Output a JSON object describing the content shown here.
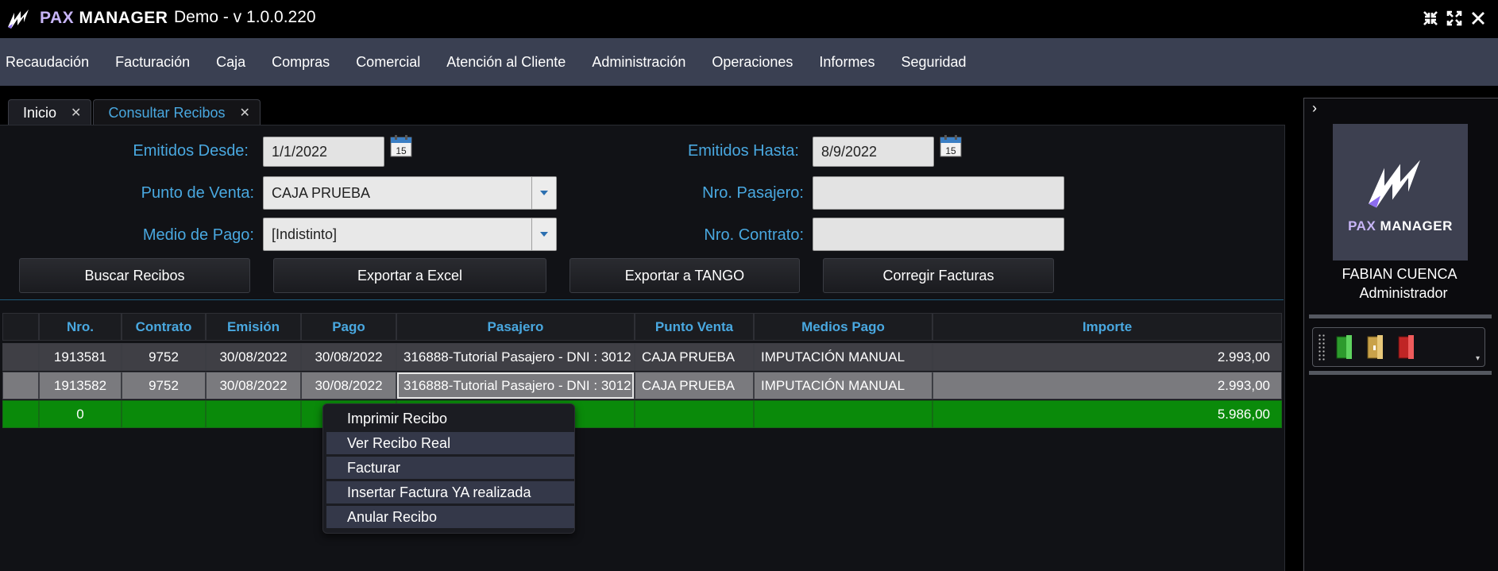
{
  "titlebar": {
    "logo_pax": "PAX",
    "logo_manager": "MANAGER",
    "title": "Demo - v 1.0.0.220"
  },
  "menu": [
    "Recaudación",
    "Facturación",
    "Caja",
    "Compras",
    "Comercial",
    "Atención al Cliente",
    "Administración",
    "Operaciones",
    "Informes",
    "Seguridad"
  ],
  "tabs": [
    {
      "label": "Inicio",
      "close": "✕"
    },
    {
      "label": "Consultar Recibos",
      "close": "✕"
    }
  ],
  "filters": {
    "desde_label": "Emitidos Desde:",
    "desde_value": "1/1/2022",
    "hasta_label": "Emitidos Hasta:",
    "hasta_value": "8/9/2022",
    "calendar_day": "15",
    "punto_label": "Punto de Venta:",
    "punto_value": "CAJA PRUEBA",
    "pasajero_label": "Nro. Pasajero:",
    "pasajero_value": "",
    "medio_label": "Medio de Pago:",
    "medio_value": "[Indistinto]",
    "contrato_label": "Nro. Contrato:",
    "contrato_value": ""
  },
  "buttons": {
    "buscar": "Buscar Recibos",
    "excel": "Exportar a Excel",
    "tango": "Exportar a TANGO",
    "corregir": "Corregir Facturas"
  },
  "grid": {
    "headers": [
      "Nro.",
      "Contrato",
      "Emisión",
      "Pago",
      "Pasajero",
      "Punto Venta",
      "Medios Pago",
      "Importe"
    ],
    "rows": [
      [
        "1913581",
        "9752",
        "30/08/2022",
        "30/08/2022",
        "316888-Tutorial Pasajero - DNI : 3012",
        "CAJA PRUEBA",
        "IMPUTACIÓN MANUAL",
        "2.993,00"
      ],
      [
        "1913582",
        "9752",
        "30/08/2022",
        "30/08/2022",
        "316888-Tutorial Pasajero - DNI : 3012",
        "CAJA PRUEBA",
        "IMPUTACIÓN MANUAL",
        "2.993,00"
      ]
    ],
    "total": {
      "nro": "0",
      "importe": "5.986,00"
    }
  },
  "context_menu": [
    "Imprimir Recibo",
    "Ver Recibo Real",
    "Facturar",
    "Insertar Factura YA realizada",
    "Anular Recibo"
  ],
  "sidebar": {
    "chevron": "›",
    "logo_pax": "PAX",
    "logo_manager": "MANAGER",
    "user_name": "FABIAN CUENCA",
    "user_role": "Administrador",
    "toolbar_icons": [
      "green-folder-icon",
      "yellow-folder-icon",
      "red-folder-icon"
    ],
    "toolbar_dropdown": "▾"
  },
  "colors": {
    "accent_blue": "#49a8e0",
    "menubar": "#3a4052",
    "total_row": "#0a8a0a",
    "logo_purple": "#c7b5f6"
  }
}
